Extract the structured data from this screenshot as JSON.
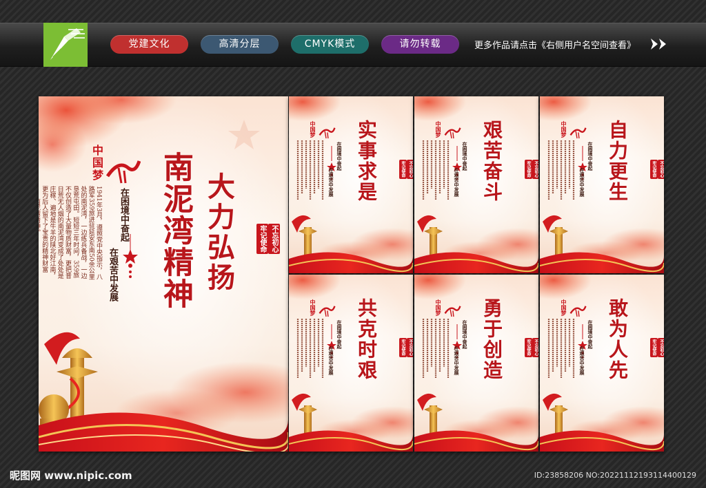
{
  "header": {
    "tags": [
      {
        "label": "党建文化",
        "color": "#c0302f"
      },
      {
        "label": "高清分层",
        "color": "#3c5872"
      },
      {
        "label": "CMYK模式",
        "color": "#1e6e6a"
      },
      {
        "label": "请勿转载",
        "color": "#6b2a86"
      }
    ],
    "note": "更多作品请点击《右侧用户名空间查看》"
  },
  "main_poster": {
    "logo_text": "中国梦",
    "title_a": "大力弘扬",
    "title_b": "南泥湾精神",
    "subtitle_a": "在困境中奋起",
    "subtitle_b": "在艰苦中发展",
    "body": "1941年3月，遵照党中央指示，八路军359旅进驻延安东南50余公里处的南泥湾，一边练兵备战，一边垦荒屯田。短短三年时间，359旅不仅创造了大量物质财富，更把昔日荒无人烟的南泥湾变成了处处是庄稼、遍地是牛羊的陕北好江南，更为后人留下了宝贵的精神财富——南泥湾精神。",
    "seal_a": "不忘初心",
    "seal_b": "牢记使命"
  },
  "small_posters": [
    {
      "title": "实事求是"
    },
    {
      "title": "艰苦奋斗"
    },
    {
      "title": "自力更生"
    },
    {
      "title": "共克时艰"
    },
    {
      "title": "勇于创造"
    },
    {
      "title": "敢为人先"
    }
  ],
  "small_common": {
    "logo_text": "中国梦",
    "subtitle_a": "在困境中奋起",
    "subtitle_b": "在艰苦中发展",
    "seal_a": "不忘初心",
    "seal_b": "牢记使命"
  },
  "footer": {
    "left": "昵图网 www.nipic.com",
    "right": "ID:23858206 NO:20221112193114400129"
  }
}
